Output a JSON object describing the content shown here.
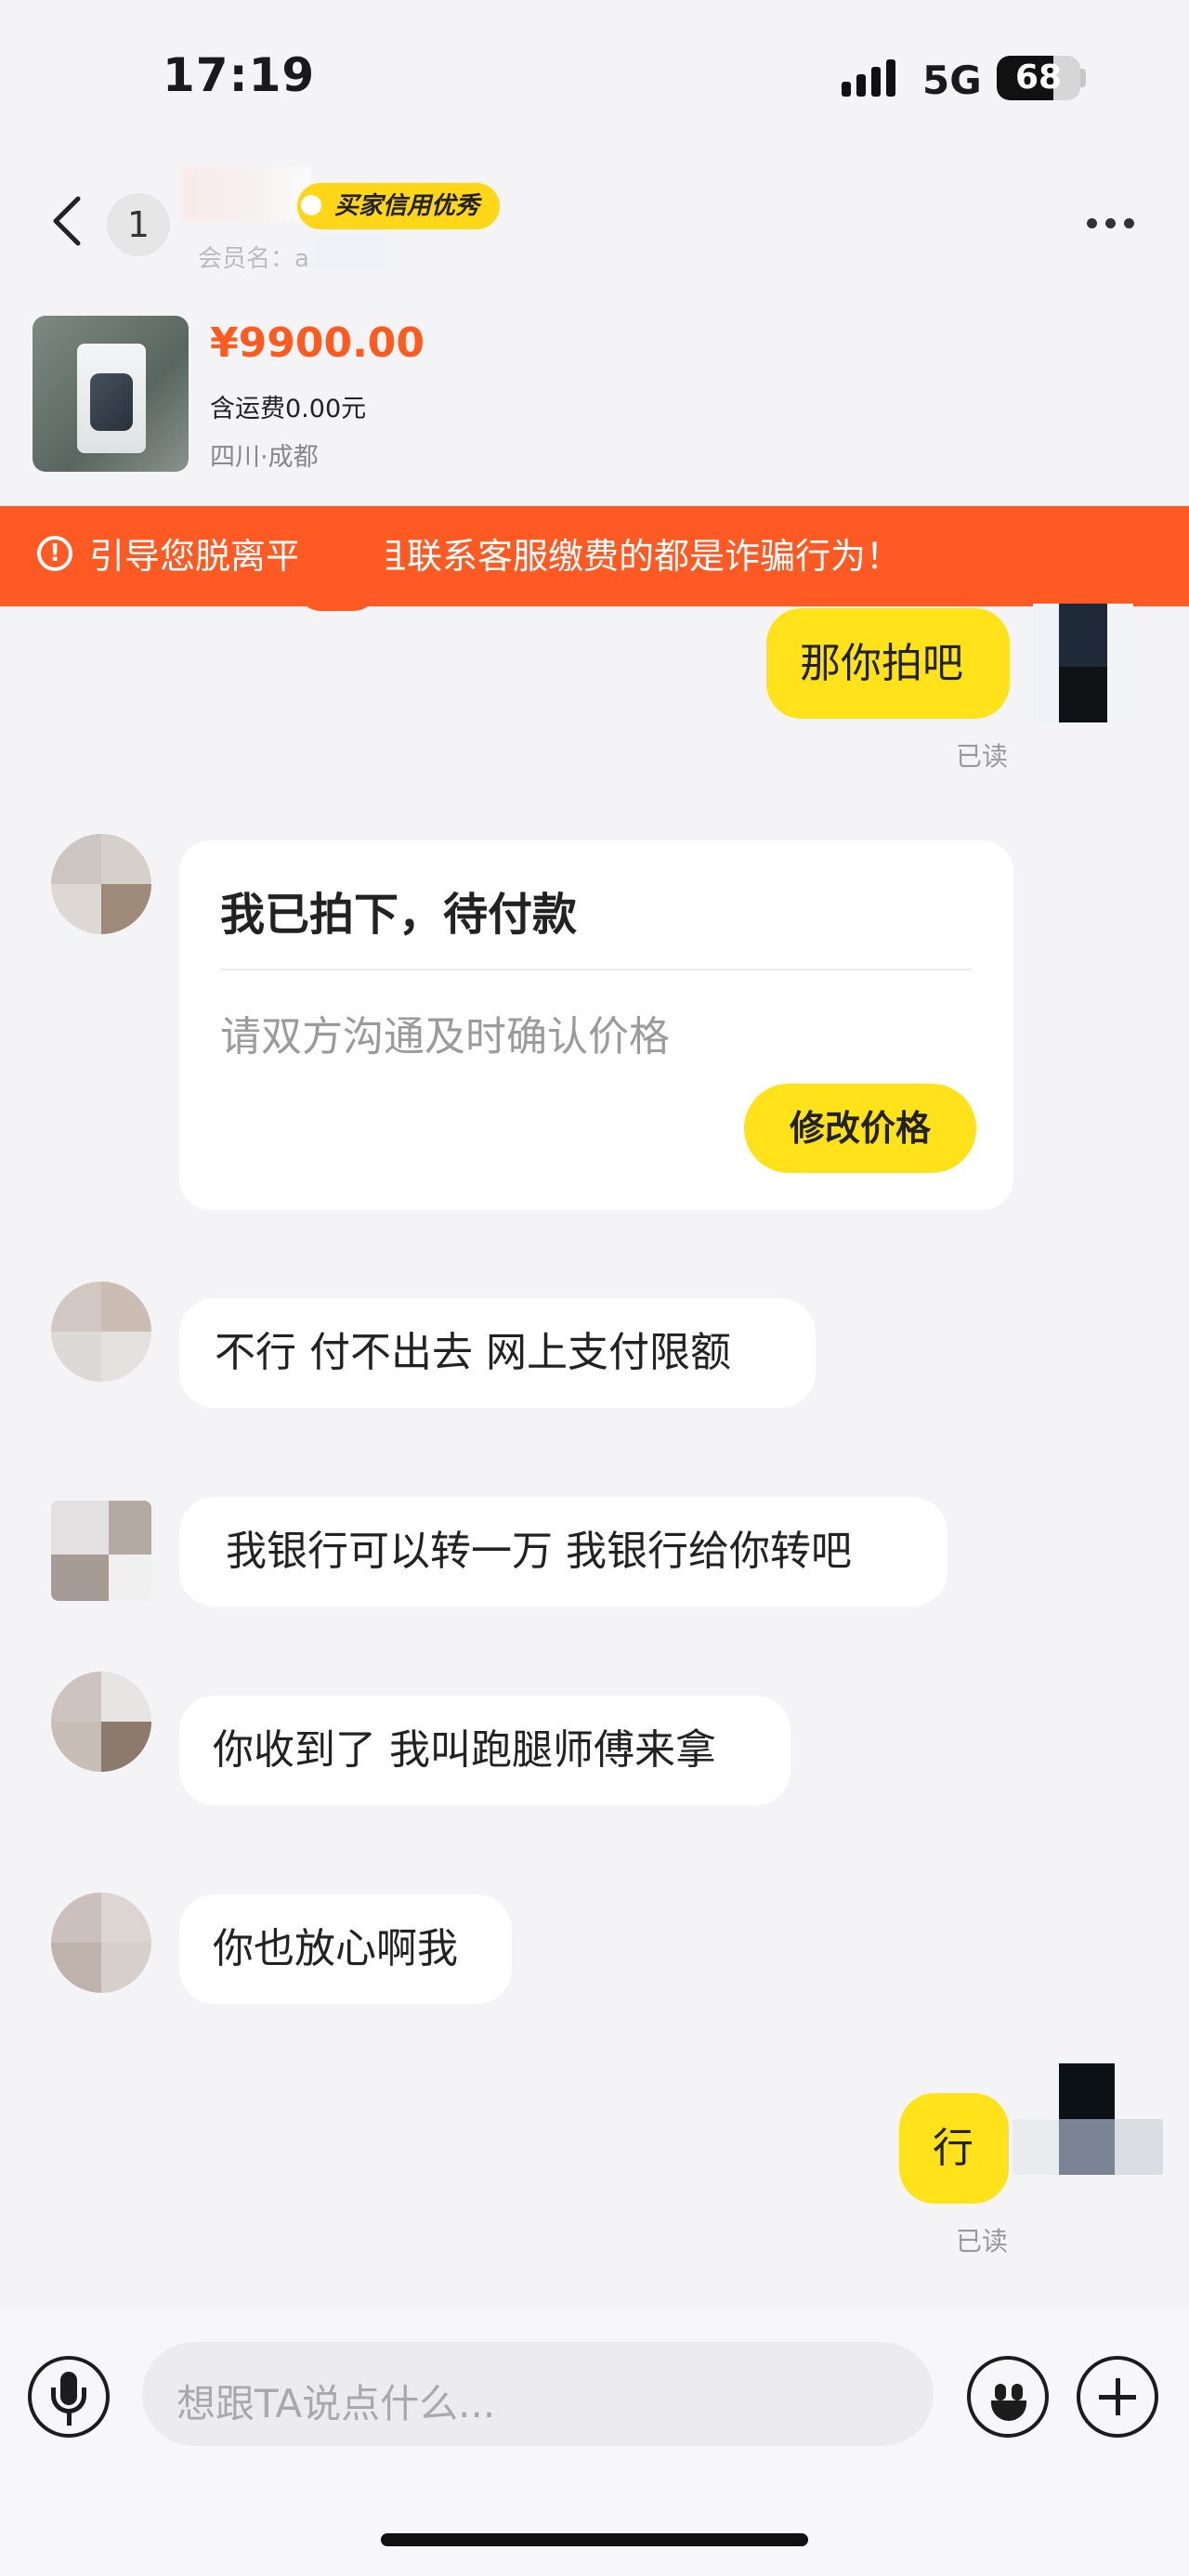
{
  "status_bar": {
    "time": "17:19",
    "network": "5G",
    "battery": "68",
    "battery_level": 0.68
  },
  "header": {
    "unread_count": "1",
    "credit_badge": "买家信用优秀",
    "member_label": "会员名：a",
    "icons": [
      "back-arrow-icon",
      "more-dots-icon"
    ]
  },
  "product": {
    "price": "¥9900.00",
    "shipping": "含运费0.00元",
    "location": "四川·成都"
  },
  "warning": {
    "text": "引导您脱离平台并且联系客服缴费的都是诈骗行为！",
    "icon": "exclamation-circle-icon",
    "color": "#ff5a24"
  },
  "messages": [
    {
      "sender": "me",
      "text": "那你拍吧",
      "status": "已读"
    },
    {
      "sender": "other",
      "type": "order_card",
      "title": "我已拍下，待付款",
      "subtitle": "请双方沟通及时确认价格",
      "button": "修改价格"
    },
    {
      "sender": "other",
      "text": "不行 付不出去 网上支付限额"
    },
    {
      "sender": "other",
      "text": "我银行可以转一万 我银行给你转吧"
    },
    {
      "sender": "other",
      "text": "你收到了 我叫跑腿师傅来拿"
    },
    {
      "sender": "other",
      "text": "你也放心啊我"
    },
    {
      "sender": "me",
      "text": "行",
      "status": "已读"
    }
  ],
  "composer": {
    "placeholder": "想跟TA说点什么...",
    "icons": [
      "microphone-icon",
      "emoji-icon",
      "plus-icon"
    ]
  },
  "colors": {
    "accent_yellow": "#ffe21a",
    "price_orange": "#ff5a1f",
    "background": "#f4f4f6"
  }
}
